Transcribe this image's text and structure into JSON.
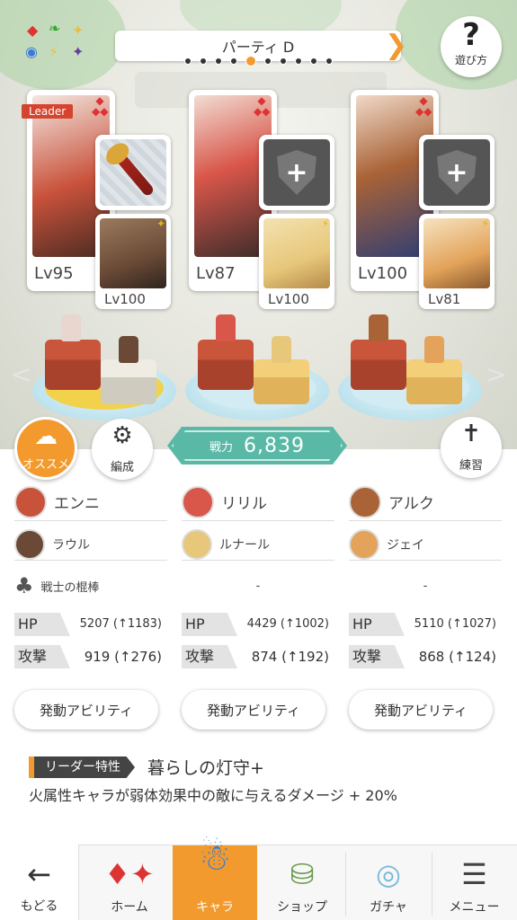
{
  "header": {
    "title": "パーティ D",
    "help_label": "遊び方",
    "party_pages": 10,
    "active_page": 5
  },
  "party": [
    {
      "leader_tag": "Leader",
      "main_level": "Lv95",
      "main_color": "#c9523b",
      "weapon": "staff",
      "sub_level": "Lv100",
      "sub_color": "#6a4a36",
      "sub_badge": "sparkle-icon"
    },
    {
      "main_level": "Lv87",
      "main_color": "#d9564a",
      "weapon": "empty",
      "sub_level": "Lv100",
      "sub_color": "#e7c77a",
      "sub_badge": "lightning-icon"
    },
    {
      "main_level": "Lv100",
      "main_color": "#a96337",
      "weapon": "empty",
      "sub_level": "Lv81",
      "sub_color": "#e3a35a",
      "sub_badge": "lightning-icon"
    }
  ],
  "buttons": {
    "recommend": "オススメ",
    "formation": "編成",
    "practice": "練習",
    "ability": "発動アビリティ"
  },
  "power": {
    "label": "戦力",
    "value": "6,839"
  },
  "columns": [
    {
      "main_name": "エンニ",
      "sub_name": "ラウル",
      "equipment": "戦士の棍棒",
      "hp_label": "HP",
      "hp_value": "5207 (↑1183)",
      "atk_label": "攻撃",
      "atk_value": "919 (↑276)"
    },
    {
      "main_name": "リリル",
      "sub_name": "ルナール",
      "equipment": "-",
      "hp_label": "HP",
      "hp_value": "4429 (↑1002)",
      "atk_label": "攻撃",
      "atk_value": "874 (↑192)"
    },
    {
      "main_name": "アルク",
      "sub_name": "ジェイ",
      "equipment": "-",
      "hp_label": "HP",
      "hp_value": "5110 (↑1027)",
      "atk_label": "攻撃",
      "atk_value": "868 (↑124)"
    }
  ],
  "leader": {
    "label": "リーダー特性",
    "skill": "暮らしの灯守+",
    "description": "火属性キャラが弱体効果中の敵に与えるダメージ + 20%"
  },
  "nav": {
    "back": "もどる",
    "items": [
      {
        "label": "ホーム",
        "icon": "home-icon"
      },
      {
        "label": "キャラ",
        "icon": "character-icon",
        "active": true
      },
      {
        "label": "ショップ",
        "icon": "shop-icon"
      },
      {
        "label": "ガチャ",
        "icon": "gacha-icon"
      },
      {
        "label": "メニュー",
        "icon": "menu-icon"
      }
    ]
  },
  "colors": {
    "accent": "#f29a2e",
    "power": "#5ab9a6",
    "leader_red": "#d4442e"
  }
}
